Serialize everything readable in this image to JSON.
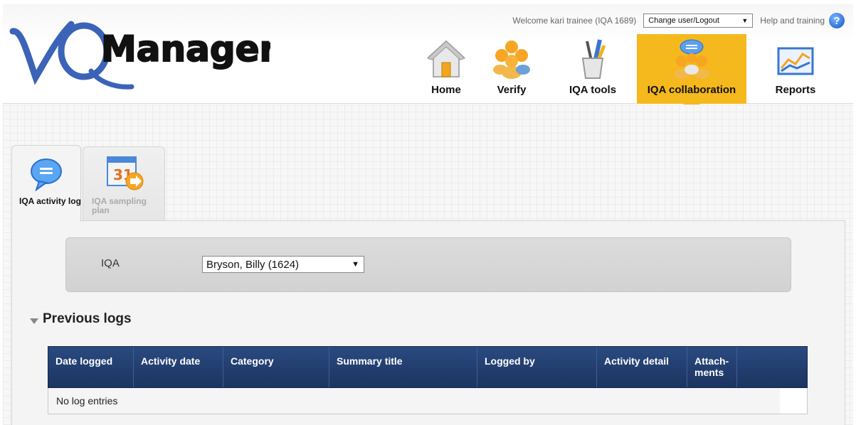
{
  "header": {
    "welcome_text": "Welcome kari trainee (IQA 1689)",
    "user_select_value": "Change user/Logout",
    "help_label": "Help and training",
    "logo_text": "VQManager"
  },
  "nav": {
    "items": [
      {
        "label": "Home",
        "icon": "home-icon"
      },
      {
        "label": "Verify",
        "icon": "verify-people-icon"
      },
      {
        "label": "IQA tools",
        "icon": "tools-cup-icon"
      },
      {
        "label": "IQA collaboration",
        "icon": "collaboration-icon",
        "active": true
      },
      {
        "label": "Reports",
        "icon": "chart-icon"
      }
    ]
  },
  "tabs": [
    {
      "label": "IQA activity log",
      "active": true,
      "icon": "speech-bubble-icon"
    },
    {
      "label": "IQA sampling plan",
      "active": false,
      "icon": "calendar-arrow-icon"
    }
  ],
  "filter": {
    "label": "IQA",
    "select_value": "Bryson, Billy (1624)"
  },
  "section": {
    "title": "Previous logs"
  },
  "table": {
    "columns": [
      "Date logged",
      "Activity date",
      "Category",
      "Summary title",
      "Logged by",
      "Activity detail",
      "Attach-ments"
    ],
    "empty_message": "No log entries"
  },
  "colors": {
    "accent": "#f5b81d",
    "table_header": "#1f3a6b",
    "help_blue": "#2c6fd8"
  }
}
